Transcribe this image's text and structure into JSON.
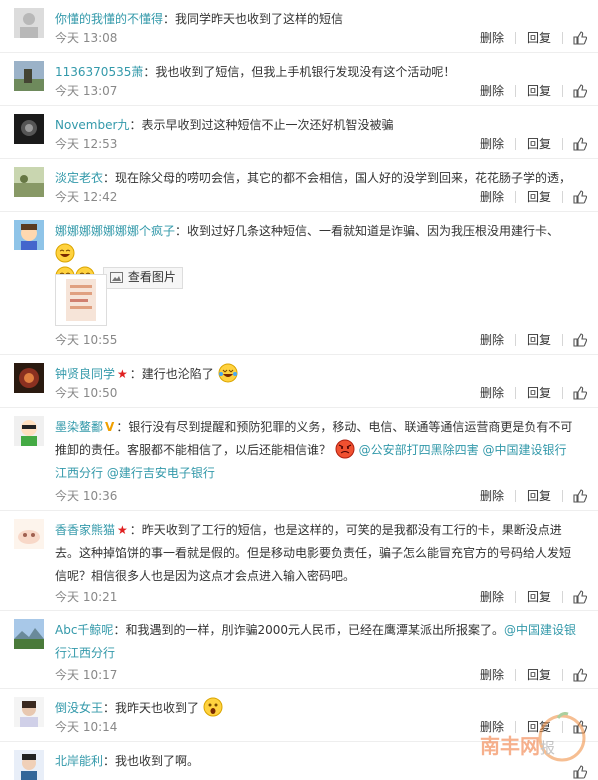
{
  "actions": {
    "delete_label": "删除",
    "reply_label": "回复"
  },
  "comments": [
    {
      "name": "你懂的我懂的不懂得",
      "sep": "：",
      "text": "我同学昨天也收到了这样的短信",
      "time": "今天 13:08"
    },
    {
      "name": "1136370535萧",
      "sep": "：",
      "text": "我也收到了短信，但我上手机银行发现没有这个活动呢！",
      "time": "今天 13:07"
    },
    {
      "name": "November九",
      "sep": "：",
      "text": "表示早收到过这种短信不止一次还好机智没被骗",
      "time": "今天 12:53"
    },
    {
      "name": "淡定老衣",
      "sep": "：",
      "text": "现在除父母的唠叨会信，其它的都不会相信，国人好的没学到回来，花花肠子学的透，",
      "time": "今天 12:42"
    },
    {
      "name": "娜娜娜娜娜娜娜个疯子",
      "sep": "：",
      "text": "收到过好几条这种短信、一看就知道是诈骗、因为我压根没用建行卡、",
      "view_pic_label": "查看图片",
      "time": "今天 10:55"
    },
    {
      "name": "钟贤良同学",
      "sep": "：",
      "text": "建行也沦陷了",
      "time": "今天 10:50"
    },
    {
      "name": "墨染鳌鄱",
      "sep": "：",
      "text1": "银行没有尽到提醒和预防犯罪的义务，移动、电信、联通等通信运营商更是负有不可推卸的责任。客服都不能相信了，以后还能相信谁？",
      "mention1": "@公安部打四黑除四害",
      "mention2": "@中国建设银行江西分行",
      "mention3": "@建行吉安电子银行",
      "time": "今天 10:36"
    },
    {
      "name": "香香家熊猫",
      "sep": "：",
      "text": "昨天收到了工行的短信，也是这样的，可笑的是我都没有工行的卡，果断没点进去。这种掉馅饼的事一看就是假的。但是移动电影要负责任，骗子怎么能冒充官方的号码给人发短信呢？相信很多人也是因为这点才会点进入输入密码吧。",
      "time": "今天 10:21"
    },
    {
      "name": "Abc千鲸呢",
      "sep": "：",
      "text": "和我遇到的一样，刖诈骗2000元人民币，已经在鹰潭某派出所报案了。",
      "mention": "@中国建设银行江西分行",
      "time": "今天 10:17"
    },
    {
      "name": "倒没女王",
      "sep": "：",
      "text": "我昨天也收到了",
      "time": "今天 10:14"
    },
    {
      "name": "北岸能利",
      "sep": "：",
      "text": "我也收到了啊。",
      "time": ""
    }
  ],
  "watermark": {
    "text1": "南丰网",
    "text2": "报"
  },
  "colors": {
    "link": "#3399aa",
    "text": "#333333",
    "meta": "#888888",
    "divider": "#eeeeee"
  }
}
